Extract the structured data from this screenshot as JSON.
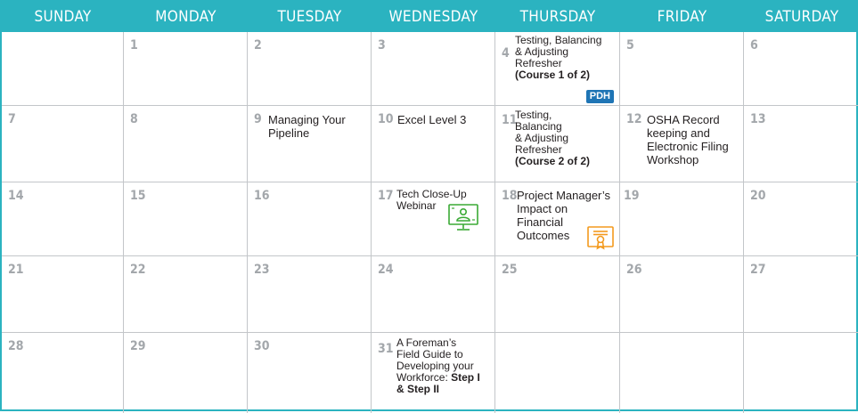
{
  "headers": [
    "SUNDAY",
    "MONDAY",
    "TUESDAY",
    "WEDNESDAY",
    "THURSDAY",
    "FRIDAY",
    "SATURDAY"
  ],
  "days": {
    "d1": "1",
    "d2": "2",
    "d3": "3",
    "d4": "4",
    "d5": "5",
    "d6": "6",
    "d7": "7",
    "d8": "8",
    "d9": "9",
    "d10": "10",
    "d11": "11",
    "d12": "12",
    "d13": "13",
    "d14": "14",
    "d15": "15",
    "d16": "16",
    "d17": "17",
    "d18": "18",
    "d19": "19",
    "d20": "20",
    "d21": "21",
    "d22": "22",
    "d23": "23",
    "d24": "24",
    "d25": "25",
    "d26": "26",
    "d27": "27",
    "d28": "28",
    "d29": "29",
    "d30": "30",
    "d31": "31"
  },
  "events": {
    "e4": "Testing, Balancing\n& Adjusting\nRefresher",
    "e4_bold": "(Course 1 of 2)",
    "e4_badge": "PDH",
    "e9": "Managing Your\nPipeline",
    "e10": "Excel Level 3",
    "e11": "Testing,\nBalancing\n& Adjusting\nRefresher",
    "e11_bold": "(Course 2 of 2)",
    "e12": "OSHA Record\nkeeping and\nElectronic Filing\nWorkshop",
    "e17": "Tech Close-Up\nWebinar",
    "e18": "Project Manager’s\nImpact on\nFinancial\nOutcomes",
    "e31": "A Foreman’s\nField Guide to\nDeveloping your\nWorkforce: ",
    "e31_bold": "Step I\n& Step II"
  },
  "icons": {
    "webinar": "webinar-monitor-icon",
    "certificate": "certificate-icon"
  },
  "colors": {
    "header_bg": "#2bb3c0",
    "day_number": "#a3a7ab",
    "pdh_badge": "#1f75b5",
    "webinar_icon": "#3aaa35",
    "certificate_icon": "#f39a1e"
  }
}
